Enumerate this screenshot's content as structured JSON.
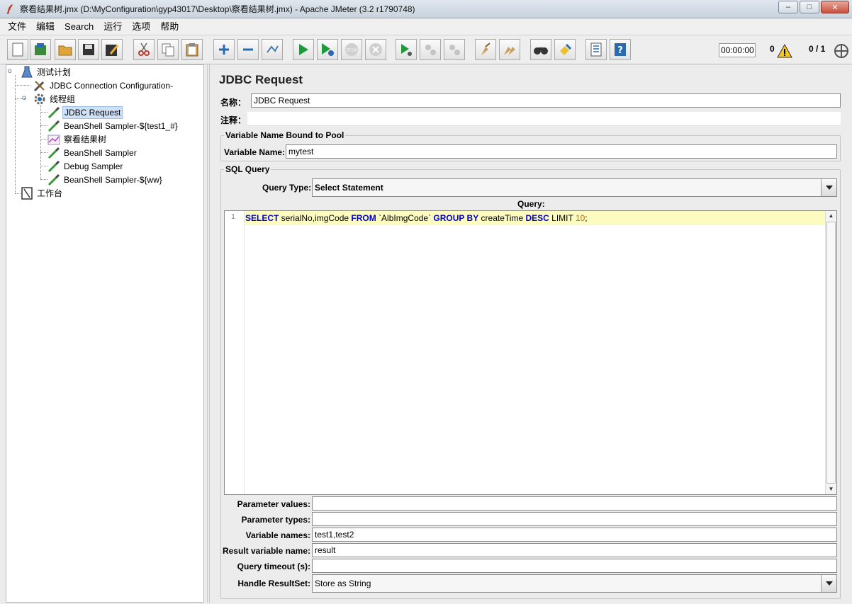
{
  "window": {
    "title": "察看结果树.jmx (D:\\MyConfiguration\\gyp43017\\Desktop\\察看结果树.jmx) - Apache JMeter (3.2 r1790748)",
    "minimize_glyph": "–",
    "maximize_glyph": "□",
    "close_glyph": "✕"
  },
  "menu": [
    "文件",
    "编辑",
    "Search",
    "运行",
    "选项",
    "帮助"
  ],
  "toolbar": {
    "timer": "00:00:00",
    "warning_count": "0",
    "thread_count": "0 / 1"
  },
  "tree": {
    "items": [
      {
        "label": "测试计划",
        "icon": "beaker-icon"
      },
      {
        "label": "JDBC Connection Configuration-",
        "icon": "wrench-icon"
      },
      {
        "label": "线程组",
        "icon": "gear-icon"
      },
      {
        "label": "JDBC Request",
        "icon": "pipette-icon"
      },
      {
        "label": "BeanShell Sampler-${test1_#}",
        "icon": "pipette-icon"
      },
      {
        "label": "察看结果树",
        "icon": "graph-icon"
      },
      {
        "label": "BeanShell Sampler",
        "icon": "pipette-icon"
      },
      {
        "label": "Debug Sampler",
        "icon": "pipette-icon"
      },
      {
        "label": "BeanShell Sampler-${ww}",
        "icon": "pipette-icon"
      },
      {
        "label": "工作台",
        "icon": "workbench-icon"
      }
    ],
    "selected_index": 3
  },
  "form": {
    "panel_title": "JDBC Request",
    "name_label": "名称：",
    "name_value": "JDBC Request",
    "comment_label": "注释：",
    "comment_value": "",
    "pool_group_title": "Variable Name Bound to Pool",
    "variable_name_label": "Variable Name:",
    "variable_name_value": "mytest",
    "sql_group_title": "SQL Query",
    "query_type_label": "Query Type:",
    "query_type_value": "Select Statement",
    "query_label": "Query:",
    "query_line_number": "1",
    "query_tokens": [
      {
        "text": "SELECT",
        "kind": "kw"
      },
      {
        "text": " serialNo,imgCode ",
        "kind": "plain"
      },
      {
        "text": "FROM",
        "kind": "kw"
      },
      {
        "text": " `AlbImgCode` ",
        "kind": "plain"
      },
      {
        "text": "GROUP BY",
        "kind": "kw"
      },
      {
        "text": " createTime ",
        "kind": "plain"
      },
      {
        "text": "DESC",
        "kind": "kw"
      },
      {
        "text": " LIMIT ",
        "kind": "plain"
      },
      {
        "text": "10",
        "kind": "num"
      },
      {
        "text": ";",
        "kind": "plain"
      }
    ],
    "parameter_values_label": "Parameter values:",
    "parameter_values_value": "",
    "parameter_types_label": "Parameter types:",
    "parameter_types_value": "",
    "variable_names_label": "Variable names:",
    "variable_names_value": "test1,test2",
    "result_variable_name_label": "Result variable name:",
    "result_variable_name_value": "result",
    "query_timeout_label": "Query timeout (s):",
    "query_timeout_value": "",
    "handle_resultset_label": "Handle ResultSet:",
    "handle_resultset_value": "Store as String"
  },
  "colors": {
    "keyword": "#0000cc",
    "number": "#cc6600",
    "current_line": "#fdfcc0",
    "selection": "#cfe1f7"
  }
}
